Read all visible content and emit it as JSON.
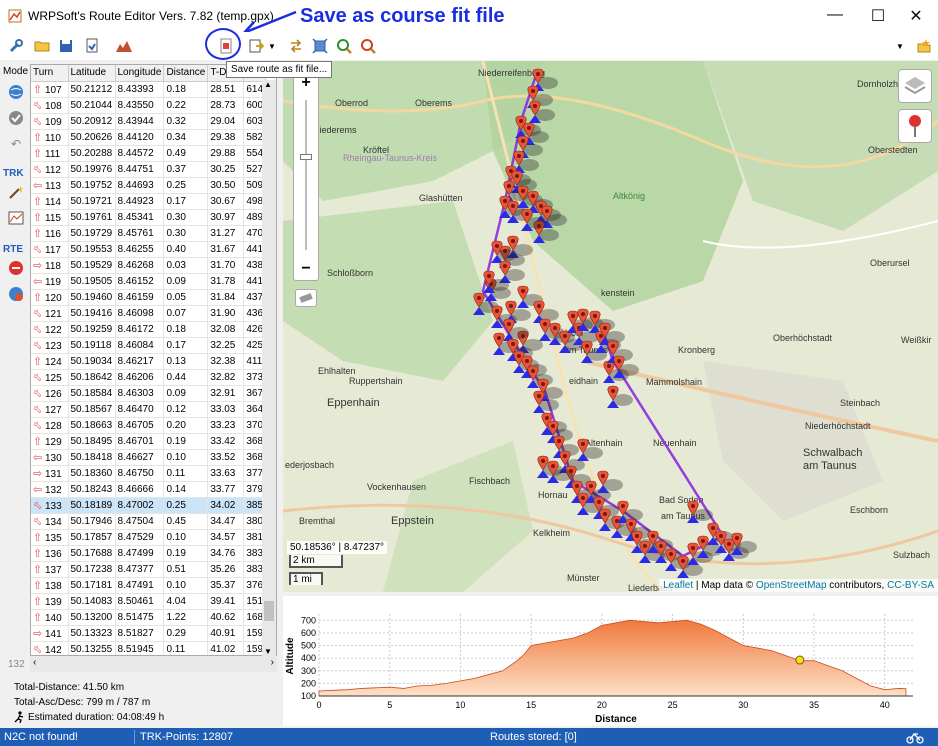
{
  "window": {
    "title": "WRPSoft's Route Editor Vers. 7.82 (temp.gpx)",
    "annotation": "Save as course fit file",
    "controls": {
      "minimize": "—",
      "maximize": "☐",
      "close": "✕"
    }
  },
  "toolbar": {
    "tooltip": "Save route as fit file..."
  },
  "modebar": {
    "mode_label": "Mode",
    "trk_label": "TRK",
    "rte_label": "RTE"
  },
  "table": {
    "columns": [
      "Turn",
      "Latitude",
      "Longitude",
      "Distance",
      "T-Dis",
      ""
    ],
    "rows": [
      {
        "turn": "107",
        "lat": "50.21212",
        "lon": "8.43393",
        "dist": "0.18",
        "tdis": "28.51",
        "alt": "614",
        "dir": "up"
      },
      {
        "turn": "108",
        "lat": "50.21044",
        "lon": "8.43550",
        "dist": "0.22",
        "tdis": "28.73",
        "alt": "600",
        "dir": "left"
      },
      {
        "turn": "109",
        "lat": "50.20912",
        "lon": "8.43944",
        "dist": "0.32",
        "tdis": "29.04",
        "alt": "603",
        "dir": "left"
      },
      {
        "turn": "110",
        "lat": "50.20626",
        "lon": "8.44120",
        "dist": "0.34",
        "tdis": "29.38",
        "alt": "582",
        "dir": "up"
      },
      {
        "turn": "111",
        "lat": "50.20288",
        "lon": "8.44572",
        "dist": "0.49",
        "tdis": "29.88",
        "alt": "554",
        "dir": "up"
      },
      {
        "turn": "112",
        "lat": "50.19976",
        "lon": "8.44751",
        "dist": "0.37",
        "tdis": "30.25",
        "alt": "527",
        "dir": "left"
      },
      {
        "turn": "113",
        "lat": "50.19752",
        "lon": "8.44693",
        "dist": "0.25",
        "tdis": "30.50",
        "alt": "509",
        "dir": "leftb"
      },
      {
        "turn": "114",
        "lat": "50.19721",
        "lon": "8.44923",
        "dist": "0.17",
        "tdis": "30.67",
        "alt": "498",
        "dir": "up"
      },
      {
        "turn": "115",
        "lat": "50.19761",
        "lon": "8.45341",
        "dist": "0.30",
        "tdis": "30.97",
        "alt": "489",
        "dir": "up"
      },
      {
        "turn": "116",
        "lat": "50.19729",
        "lon": "8.45761",
        "dist": "0.30",
        "tdis": "31.27",
        "alt": "470",
        "dir": "up"
      },
      {
        "turn": "117",
        "lat": "50.19553",
        "lon": "8.46255",
        "dist": "0.40",
        "tdis": "31.67",
        "alt": "441",
        "dir": "left"
      },
      {
        "turn": "118",
        "lat": "50.19529",
        "lon": "8.46268",
        "dist": "0.03",
        "tdis": "31.70",
        "alt": "438",
        "dir": "right"
      },
      {
        "turn": "119",
        "lat": "50.19505",
        "lon": "8.46152",
        "dist": "0.09",
        "tdis": "31.78",
        "alt": "441",
        "dir": "leftb"
      },
      {
        "turn": "120",
        "lat": "50.19460",
        "lon": "8.46159",
        "dist": "0.05",
        "tdis": "31.84",
        "alt": "437",
        "dir": "up"
      },
      {
        "turn": "121",
        "lat": "50.19416",
        "lon": "8.46098",
        "dist": "0.07",
        "tdis": "31.90",
        "alt": "436",
        "dir": "left"
      },
      {
        "turn": "122",
        "lat": "50.19259",
        "lon": "8.46172",
        "dist": "0.18",
        "tdis": "32.08",
        "alt": "426",
        "dir": "left"
      },
      {
        "turn": "123",
        "lat": "50.19118",
        "lon": "8.46084",
        "dist": "0.17",
        "tdis": "32.25",
        "alt": "425",
        "dir": "left"
      },
      {
        "turn": "124",
        "lat": "50.19034",
        "lon": "8.46217",
        "dist": "0.13",
        "tdis": "32.38",
        "alt": "411",
        "dir": "up"
      },
      {
        "turn": "125",
        "lat": "50.18642",
        "lon": "8.46206",
        "dist": "0.44",
        "tdis": "32.82",
        "alt": "373",
        "dir": "left"
      },
      {
        "turn": "126",
        "lat": "50.18584",
        "lon": "8.46303",
        "dist": "0.09",
        "tdis": "32.91",
        "alt": "367",
        "dir": "left"
      },
      {
        "turn": "127",
        "lat": "50.18567",
        "lon": "8.46470",
        "dist": "0.12",
        "tdis": "33.03",
        "alt": "364",
        "dir": "left"
      },
      {
        "turn": "128",
        "lat": "50.18663",
        "lon": "8.46705",
        "dist": "0.20",
        "tdis": "33.23",
        "alt": "370",
        "dir": "left"
      },
      {
        "turn": "129",
        "lat": "50.18495",
        "lon": "8.46701",
        "dist": "0.19",
        "tdis": "33.42",
        "alt": "368",
        "dir": "up"
      },
      {
        "turn": "130",
        "lat": "50.18418",
        "lon": "8.46627",
        "dist": "0.10",
        "tdis": "33.52",
        "alt": "368",
        "dir": "leftb"
      },
      {
        "turn": "131",
        "lat": "50.18360",
        "lon": "8.46750",
        "dist": "0.11",
        "tdis": "33.63",
        "alt": "377",
        "dir": "right"
      },
      {
        "turn": "132",
        "lat": "50.18243",
        "lon": "8.46666",
        "dist": "0.14",
        "tdis": "33.77",
        "alt": "379",
        "dir": "leftb"
      },
      {
        "turn": "133",
        "lat": "50.18189",
        "lon": "8.47002",
        "dist": "0.25",
        "tdis": "34.02",
        "alt": "385",
        "dir": "left"
      },
      {
        "turn": "134",
        "lat": "50.17946",
        "lon": "8.47504",
        "dist": "0.45",
        "tdis": "34.47",
        "alt": "380",
        "dir": "left"
      },
      {
        "turn": "135",
        "lat": "50.17857",
        "lon": "8.47529",
        "dist": "0.10",
        "tdis": "34.57",
        "alt": "381",
        "dir": "up"
      },
      {
        "turn": "136",
        "lat": "50.17688",
        "lon": "8.47499",
        "dist": "0.19",
        "tdis": "34.76",
        "alt": "383",
        "dir": "up"
      },
      {
        "turn": "137",
        "lat": "50.17238",
        "lon": "8.47377",
        "dist": "0.51",
        "tdis": "35.26",
        "alt": "383",
        "dir": "up"
      },
      {
        "turn": "138",
        "lat": "50.17181",
        "lon": "8.47491",
        "dist": "0.10",
        "tdis": "35.37",
        "alt": "376",
        "dir": "up"
      },
      {
        "turn": "139",
        "lat": "50.14083",
        "lon": "8.50461",
        "dist": "4.04",
        "tdis": "39.41",
        "alt": "151",
        "dir": "up"
      },
      {
        "turn": "140",
        "lat": "50.13200",
        "lon": "8.51475",
        "dist": "1.22",
        "tdis": "40.62",
        "alt": "168",
        "dir": "up"
      },
      {
        "turn": "141",
        "lat": "50.13323",
        "lon": "8.51827",
        "dist": "0.29",
        "tdis": "40.91",
        "alt": "159",
        "dir": "right"
      },
      {
        "turn": "142",
        "lat": "50.13255",
        "lon": "8.51945",
        "dist": "0.11",
        "tdis": "41.02",
        "alt": "159",
        "dir": "left"
      }
    ],
    "selected_turn": "133"
  },
  "row_count": "132",
  "summary": {
    "total_distance": "Total-Distance: 41.50 km",
    "asc_desc": "Total-Asc/Desc: 799 m / 787 m",
    "duration": "Estimated duration: 04:08:49 h"
  },
  "map": {
    "zoom_in": "+",
    "zoom_out": "−",
    "coords": "50.18536° | 8.47237°",
    "scale_km": "2 km",
    "scale_mi": "1 mi",
    "attribution_leaflet": "Leaflet",
    "attribution_text": " | Map data © ",
    "attribution_osm": "OpenStreetMap",
    "attribution_contrib": " contributors, ",
    "attribution_license": "CC-BY-SA",
    "places": [
      {
        "name": "Niederreifenberg",
        "c": "#333"
      },
      {
        "name": "Oberrod",
        "c": "#333"
      },
      {
        "name": "Oberems",
        "c": "#333"
      },
      {
        "name": "Dornholzhausen",
        "c": "#333"
      },
      {
        "name": "Niederems",
        "c": "#333"
      },
      {
        "name": "Kröftel",
        "c": "#333"
      },
      {
        "name": "Oberstedten",
        "c": "#333"
      },
      {
        "name": "Rheingau-Taunus-Kreis",
        "c": "#a07ab0"
      },
      {
        "name": "Glashütten",
        "c": "#333"
      },
      {
        "name": "Altkönig",
        "c": "#3a8a3a"
      },
      {
        "name": "Schloßborn",
        "c": "#333"
      },
      {
        "name": "Oberursel",
        "c": "#333"
      },
      {
        "name": "kenstein",
        "c": "#333"
      },
      {
        "name": "Köni",
        "c": "#333"
      },
      {
        "name": "im Taunus",
        "c": "#333"
      },
      {
        "name": "Kronberg",
        "c": "#333"
      },
      {
        "name": "Oberhöchstadt",
        "c": "#333"
      },
      {
        "name": "Weißkir",
        "c": "#333"
      },
      {
        "name": "Ruppertshain",
        "c": "#333"
      },
      {
        "name": "Ehlhalten",
        "c": "#333"
      },
      {
        "name": "Eppenhain",
        "c": "#333"
      },
      {
        "name": "eidhain",
        "c": "#333"
      },
      {
        "name": "Mammolshain",
        "c": "#333"
      },
      {
        "name": "Steinbach",
        "c": "#333"
      },
      {
        "name": "Altenhain",
        "c": "#333"
      },
      {
        "name": "Neuenhain",
        "c": "#333"
      },
      {
        "name": "Niederhöchstadt",
        "c": "#333"
      },
      {
        "name": "ederjosbach",
        "c": "#333"
      },
      {
        "name": "Schwalbach",
        "c": "#333"
      },
      {
        "name": "am Taunus",
        "c": "#333"
      },
      {
        "name": "Fischbach",
        "c": "#333"
      },
      {
        "name": "Vockenhausen",
        "c": "#333"
      },
      {
        "name": "Hornau",
        "c": "#333"
      },
      {
        "name": "Bad Soden",
        "c": "#333"
      },
      {
        "name": "am Taunus",
        "c": "#333"
      },
      {
        "name": "Bremthal",
        "c": "#333"
      },
      {
        "name": "Eppstein",
        "c": "#333"
      },
      {
        "name": "Kelkheim",
        "c": "#333"
      },
      {
        "name": "Eschborn",
        "c": "#333"
      },
      {
        "name": "Sulzbach",
        "c": "#333"
      },
      {
        "name": "Münster",
        "c": "#333"
      },
      {
        "name": "Liederbach",
        "c": "#333"
      }
    ]
  },
  "colors": {
    "accent": "#1e5fb5",
    "annotation": "#1a2de0",
    "marker": "#e8543a",
    "route": "#8a2be2",
    "elev_top": "#f07a3c",
    "elev_bottom": "#fde0c8"
  },
  "chart_data": {
    "type": "area",
    "title": "",
    "xlabel": "Distance",
    "ylabel": "Altitude",
    "xlim": [
      0,
      42
    ],
    "ylim": [
      100,
      750
    ],
    "xticks": [
      0,
      5,
      10,
      15,
      20,
      25,
      30,
      35,
      40
    ],
    "yticks": [
      100,
      200,
      300,
      400,
      500,
      600,
      700
    ],
    "x": [
      0,
      1,
      2,
      3,
      4,
      5,
      6,
      7,
      8,
      9,
      10,
      11,
      12,
      13,
      14,
      14.5,
      15,
      16,
      17,
      18,
      19,
      20,
      21,
      22,
      23,
      24,
      25,
      26,
      27,
      28,
      29,
      30,
      31,
      32,
      33,
      34,
      35,
      36,
      37,
      38,
      39,
      40,
      41,
      41.5
    ],
    "y": [
      140,
      145,
      150,
      160,
      165,
      170,
      160,
      180,
      185,
      200,
      220,
      240,
      270,
      300,
      380,
      430,
      500,
      520,
      540,
      560,
      600,
      660,
      680,
      700,
      690,
      680,
      690,
      700,
      670,
      620,
      560,
      500,
      480,
      460,
      420,
      380,
      380,
      340,
      300,
      240,
      180,
      150,
      160,
      158
    ],
    "marker": {
      "x": 34,
      "y": 385
    }
  },
  "statusbar": {
    "n2c": "N2C not found!",
    "trk_points": "TRK-Points: 12807",
    "routes": "Routes stored: [0]"
  }
}
